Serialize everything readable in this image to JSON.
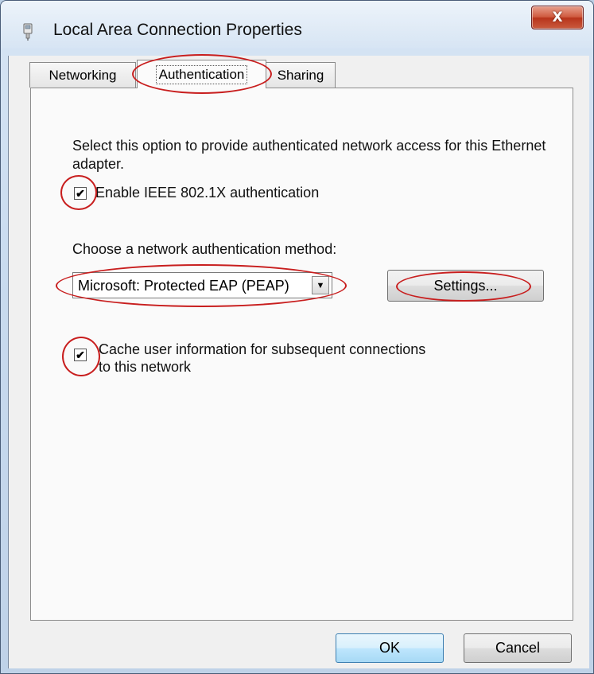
{
  "window": {
    "title": "Local Area Connection Properties",
    "close_label": "X"
  },
  "tabs": [
    {
      "label": "Networking"
    },
    {
      "label": "Authentication"
    },
    {
      "label": "Sharing"
    }
  ],
  "panel": {
    "description": "Select this option to provide authenticated network access for this Ethernet adapter.",
    "enable_label": "Enable IEEE 802.1X authentication",
    "enable_checked": true,
    "method_label": "Choose a network authentication method:",
    "method_value": "Microsoft: Protected EAP (PEAP)",
    "settings_label": "Settings...",
    "cache_label_1": "Cache user information for subsequent connections",
    "cache_label_2": "to this network",
    "cache_checked": true
  },
  "footer": {
    "ok_label": "OK",
    "cancel_label": "Cancel"
  },
  "colors": {
    "annotation": "#c81e1e",
    "close_button": "#c94a2e"
  },
  "icons": {
    "title": "network-adapter-icon",
    "check": "checkmark-icon",
    "dropdown": "chevron-down-icon"
  }
}
